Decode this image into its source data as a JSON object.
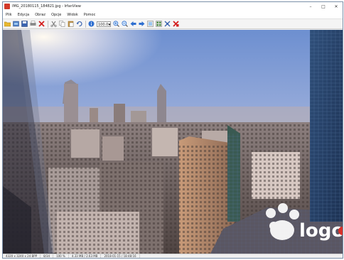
{
  "window": {
    "title": "IMG_20180115_184821.jpg - IrfanView",
    "controls": {
      "minimize": "–",
      "maximize": "□",
      "close": "✕"
    }
  },
  "menu": [
    "Plik",
    "Edycja",
    "Obraz",
    "Opcje",
    "Widok",
    "Pomoc"
  ],
  "toolbar": {
    "icons": [
      "open-folder-icon",
      "slideshow-icon",
      "save-icon",
      "print-icon",
      "delete-icon",
      "cut-icon",
      "copy-icon",
      "paste-icon",
      "undo-icon",
      "info-icon",
      "zoom-in-icon",
      "zoom-out-icon",
      "previous-icon",
      "next-icon",
      "fit-icon",
      "thumbnails-icon",
      "settings-icon",
      "exit-icon"
    ],
    "zoom_value": "100.0"
  },
  "image": {
    "watermark": "logo",
    "colors": {
      "sky_top": "#7f9ed6",
      "sky_bottom": "#c8d2e8",
      "sun": "#fff6e0",
      "accent_red": "#d8312a"
    }
  },
  "status": {
    "dimensions": "4320 x 3240 x 24 BPP",
    "index": "8/34",
    "zoom": "100 %",
    "size": "4.33 MB / 2.63 MB",
    "date": "2018-01-15 / 18:48:16"
  }
}
